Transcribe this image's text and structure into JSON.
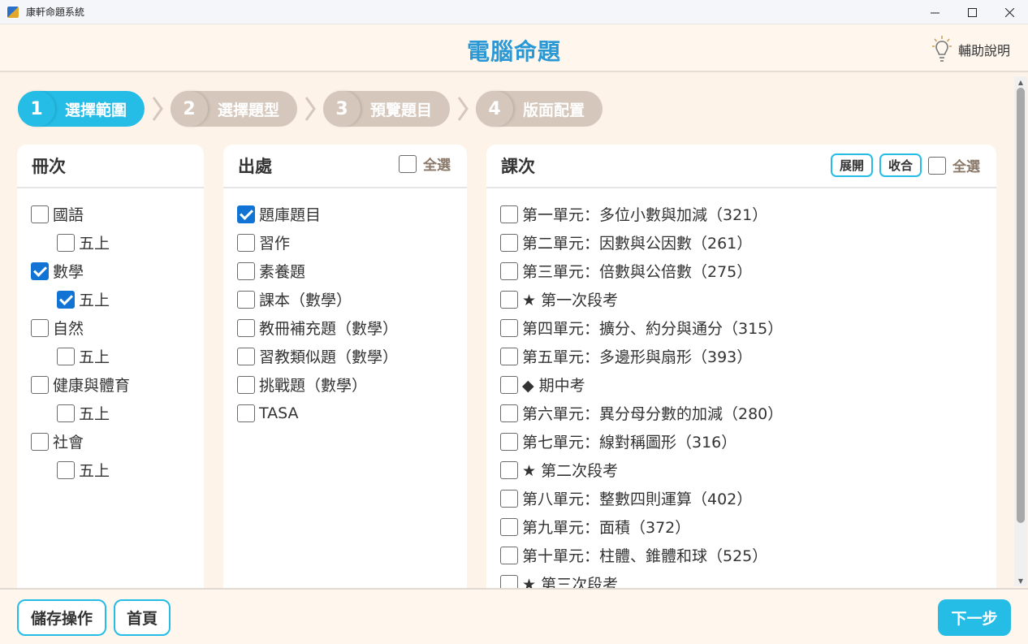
{
  "window": {
    "title": "康軒命題系統",
    "icon": "app-logo-icon"
  },
  "header": {
    "title": "電腦命題",
    "help_label": "輔助說明",
    "help_icon": "lightbulb-icon"
  },
  "steps": [
    {
      "num": "1",
      "label": "選擇範圍",
      "active": true
    },
    {
      "num": "2",
      "label": "選擇題型",
      "active": false
    },
    {
      "num": "3",
      "label": "預覽題目",
      "active": false
    },
    {
      "num": "4",
      "label": "版面配置",
      "active": false
    }
  ],
  "volume_panel": {
    "title": "冊次",
    "items": [
      {
        "label": "國語",
        "checked": false,
        "indent": 0
      },
      {
        "label": "五上",
        "checked": false,
        "indent": 1
      },
      {
        "label": "數學",
        "checked": true,
        "indent": 0
      },
      {
        "label": "五上",
        "checked": true,
        "indent": 1
      },
      {
        "label": "自然",
        "checked": false,
        "indent": 0
      },
      {
        "label": "五上",
        "checked": false,
        "indent": 1
      },
      {
        "label": "健康與體育",
        "checked": false,
        "indent": 0
      },
      {
        "label": "五上",
        "checked": false,
        "indent": 1
      },
      {
        "label": "社會",
        "checked": false,
        "indent": 0
      },
      {
        "label": "五上",
        "checked": false,
        "indent": 1
      }
    ]
  },
  "source_panel": {
    "title": "出處",
    "select_all_label": "全選",
    "items": [
      {
        "label": "題庫題目",
        "checked": true
      },
      {
        "label": "習作",
        "checked": false
      },
      {
        "label": "素養題",
        "checked": false
      },
      {
        "label": "課本（數學）",
        "checked": false
      },
      {
        "label": "教冊補充題（數學）",
        "checked": false
      },
      {
        "label": "習教類似題（數學）",
        "checked": false
      },
      {
        "label": "挑戰題（數學）",
        "checked": false
      },
      {
        "label": "TASA",
        "checked": false
      }
    ]
  },
  "lesson_panel": {
    "title": "課次",
    "expand_label": "展開",
    "collapse_label": "收合",
    "select_all_label": "全選",
    "items": [
      {
        "label": "第一單元：多位小數與加減（321）",
        "checked": false
      },
      {
        "label": "第二單元：因數與公因數（261）",
        "checked": false
      },
      {
        "label": "第三單元：倍數與公倍數（275）",
        "checked": false
      },
      {
        "label": "★ 第一次段考",
        "checked": false
      },
      {
        "label": "第四單元：擴分、約分與通分（315）",
        "checked": false
      },
      {
        "label": "第五單元：多邊形與扇形（393）",
        "checked": false
      },
      {
        "label": "◆ 期中考",
        "checked": false
      },
      {
        "label": "第六單元：異分母分數的加減（280）",
        "checked": false
      },
      {
        "label": "第七單元：線對稱圖形（316）",
        "checked": false
      },
      {
        "label": "★ 第二次段考",
        "checked": false
      },
      {
        "label": "第八單元：整數四則運算（402）",
        "checked": false
      },
      {
        "label": "第九單元：面積（372）",
        "checked": false
      },
      {
        "label": "第十單元：柱體、錐體和球（525）",
        "checked": false
      },
      {
        "label": "★ 第三次段考",
        "checked": false
      }
    ]
  },
  "footer": {
    "save_label": "儲存操作",
    "home_label": "首頁",
    "next_label": "下一步"
  },
  "colors": {
    "accent": "#25bde6",
    "title_blue": "#2a98d4",
    "checkbox_checked": "#1173d4",
    "step_inactive": "#d5c7bb",
    "background": "#fdf3e8"
  }
}
